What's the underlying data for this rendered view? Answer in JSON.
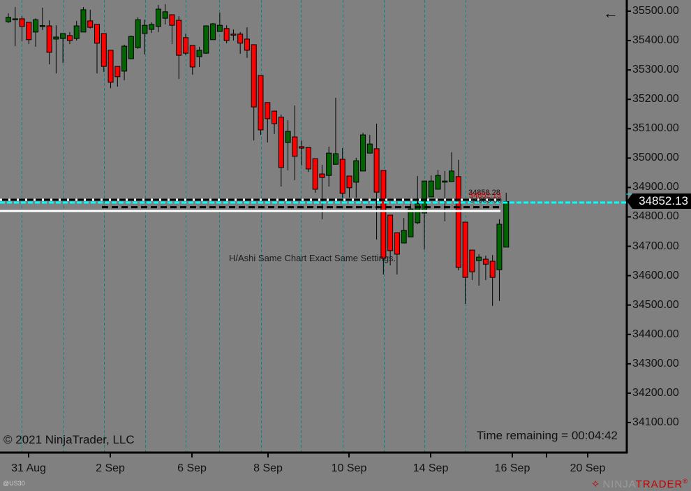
{
  "window": {
    "symbol": "@US30",
    "copyright": "© 2021 NinjaTrader, LLC",
    "time_remaining": "Time remaining = 00:04:42",
    "back_icon": "arrow-left-icon",
    "logo_text_a": "NINJA",
    "logo_text_b": "TRADER",
    "logo_reg": "®"
  },
  "colors": {
    "background": "#808080",
    "up_candle": "#006400",
    "down_candle": "#ff0000",
    "session_line": "#008b8b",
    "last_price_line": "#00ffff"
  },
  "chart_data": {
    "type": "candlestick",
    "annotation": "H/Ashi Same Chart Exact Same Settings.",
    "ylim": [
      34060,
      35540
    ],
    "y_ticks": [
      "35500.00",
      "35400.00",
      "35300.00",
      "35200.00",
      "35100.00",
      "35000.00",
      "34900.00",
      "34800.00",
      "34700.00",
      "34600.00",
      "34500.00",
      "34400.00",
      "34300.00",
      "34200.00",
      "34100.00"
    ],
    "x_ticks": [
      "31 Aug",
      "2 Sep",
      "6 Sep",
      "8 Sep",
      "10 Sep",
      "14 Sep",
      "16 Sep",
      "20 Sep"
    ],
    "last_price": "34852.13",
    "levels": [
      {
        "price": 34858.28,
        "label": "34858.28",
        "style": "black-white-dashed"
      },
      {
        "price": 34852.13,
        "label": "34852.13",
        "style": "cyan-dashed"
      },
      {
        "price": 34833.0,
        "label": "34833.00",
        "style": "black-dashed"
      },
      {
        "price": 34820.0,
        "style": "white-solid"
      }
    ],
    "ohlc": [
      [
        35464,
        35493,
        35460,
        35479
      ],
      [
        35471,
        35514,
        35381,
        35474
      ],
      [
        35474,
        35483,
        35398,
        35448
      ],
      [
        35462,
        35462,
        35388,
        35403
      ],
      [
        35429,
        35476,
        35379,
        35471
      ],
      [
        35450,
        35512,
        35436,
        35451
      ],
      [
        35450,
        35469,
        35319,
        35360
      ],
      [
        35405,
        35452,
        35288,
        35412
      ],
      [
        35407,
        35424,
        35324,
        35424
      ],
      [
        35417,
        35429,
        35388,
        35400
      ],
      [
        35407,
        35467,
        35400,
        35450
      ],
      [
        35429,
        35514,
        35429,
        35505
      ],
      [
        35467,
        35505,
        35441,
        35445
      ],
      [
        35455,
        35455,
        35288,
        35391
      ],
      [
        35424,
        35424,
        35293,
        35312
      ],
      [
        35367,
        35367,
        35238,
        35258
      ],
      [
        35312,
        35312,
        35243,
        35277
      ],
      [
        35296,
        35386,
        35265,
        35381
      ],
      [
        35338,
        35417,
        35338,
        35414
      ],
      [
        35376,
        35479,
        35372,
        35471
      ],
      [
        35424,
        35471,
        35353,
        35452
      ],
      [
        35438,
        35462,
        35426,
        35455
      ],
      [
        35448,
        35521,
        35429,
        35507
      ],
      [
        35476,
        35524,
        35455,
        35498
      ],
      [
        35488,
        35488,
        35388,
        35452
      ],
      [
        35469,
        35483,
        35269,
        35350
      ],
      [
        35410,
        35424,
        35350,
        35357
      ],
      [
        35383,
        35383,
        35284,
        35310
      ],
      [
        35345,
        35379,
        35310,
        35367
      ],
      [
        35357,
        35452,
        35355,
        35450
      ],
      [
        35403,
        35460,
        35403,
        35457
      ],
      [
        35431,
        35495,
        35431,
        35452
      ],
      [
        35441,
        35452,
        35391,
        35400
      ],
      [
        35422,
        35438,
        35400,
        35421
      ],
      [
        35422,
        35429,
        35355,
        35391
      ],
      [
        35405,
        35445,
        35341,
        35367
      ],
      [
        35386,
        35386,
        35060,
        35174
      ],
      [
        35281,
        35281,
        35079,
        35096
      ],
      [
        35189,
        35189,
        35053,
        35134
      ],
      [
        35160,
        35160,
        35082,
        35117
      ],
      [
        35139,
        35148,
        34903,
        34968
      ],
      [
        35053,
        35129,
        34958,
        35091
      ],
      [
        35072,
        35179,
        34925,
        35006
      ],
      [
        35039,
        35060,
        34975,
        35034
      ],
      [
        35036,
        35036,
        34953,
        34963
      ],
      [
        34998,
        34998,
        34882,
        34894
      ],
      [
        34946,
        34977,
        34792,
        34934
      ],
      [
        34941,
        35039,
        34903,
        35017
      ],
      [
        34979,
        35205,
        34979,
        35015
      ],
      [
        34996,
        35034,
        34865,
        34880
      ],
      [
        34939,
        34939,
        34865,
        34899
      ],
      [
        34918,
        35001,
        34865,
        34991
      ],
      [
        34956,
        35086,
        34956,
        35079
      ],
      [
        35017,
        35079,
        35017,
        35048
      ],
      [
        35032,
        35117,
        34723,
        34884
      ],
      [
        34958,
        34958,
        34604,
        34659
      ],
      [
        34806,
        34806,
        34635,
        34685
      ],
      [
        34746,
        34746,
        34604,
        34673
      ],
      [
        34711,
        34796,
        34711,
        34754
      ],
      [
        34732,
        34844,
        34732,
        34827
      ],
      [
        34780,
        34939,
        34775,
        34846
      ],
      [
        34813,
        34922,
        34689,
        34922
      ],
      [
        34868,
        34941,
        34868,
        34922
      ],
      [
        34894,
        34960,
        34894,
        34941
      ],
      [
        34918,
        34956,
        34785,
        34922
      ],
      [
        34920,
        35020,
        34920,
        34956
      ],
      [
        34937,
        34994,
        34618,
        34628
      ],
      [
        34782,
        34782,
        34504,
        34594
      ],
      [
        34687,
        34687,
        34585,
        34613
      ],
      [
        34651,
        34673,
        34566,
        34663
      ],
      [
        34656,
        34668,
        34585,
        34639
      ],
      [
        34649,
        34670,
        34497,
        34594
      ],
      [
        34620,
        34792,
        34514,
        34775
      ],
      [
        34697,
        34882,
        34697,
        34852.13
      ]
    ]
  }
}
